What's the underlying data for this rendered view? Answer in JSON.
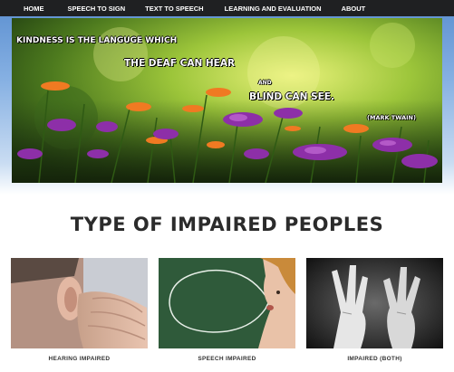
{
  "nav": {
    "items": [
      {
        "label": "HOME"
      },
      {
        "label": "SPEECH TO SIGN"
      },
      {
        "label": "TEXT TO SPEECH"
      },
      {
        "label": "LEARNING AND EVALUATION"
      },
      {
        "label": "ABOUT"
      }
    ]
  },
  "hero": {
    "quote_line1": "KINDNESS IS THE LANGUGE WHICH",
    "quote_line2": "THE DEAF CAN HEAR",
    "quote_and": "AND",
    "quote_line3": "BLIND CAN SEE.",
    "quote_author": "(MARK TWAIN)",
    "image": "flower-garden-photo"
  },
  "section": {
    "title": "TYPE OF IMPAIRED PEOPLES"
  },
  "cards": [
    {
      "caption": "HEARING IMPAIRED",
      "image": "hand-behind-ear-photo"
    },
    {
      "caption": "SPEECH IMPAIRED",
      "image": "girl-with-speech-bubble-photo"
    },
    {
      "caption": "IMPAIRED (BOTH)",
      "image": "sign-language-hands-photo"
    }
  ],
  "colors": {
    "navbar": "#1f2022",
    "title": "#2b2b2b",
    "chalkboard": "#2f5a3a"
  }
}
